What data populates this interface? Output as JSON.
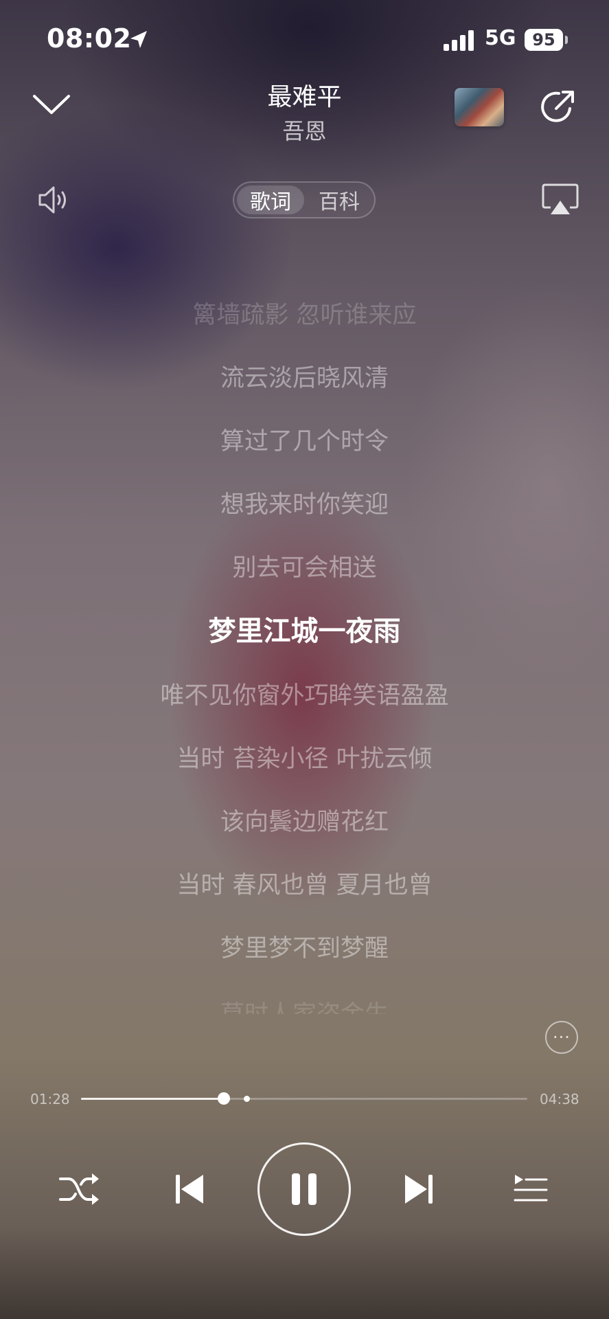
{
  "status_bar": {
    "time": "08:02",
    "network": "5G",
    "battery": "95",
    "icons": [
      "location-arrow-icon",
      "cellular-signal-icon"
    ]
  },
  "header": {
    "title": "最难平",
    "artist": "吾恩",
    "icons": [
      "chevron-down-icon",
      "album-cover-thumbnail",
      "share-icon"
    ]
  },
  "tabs": {
    "lyrics": "歌词",
    "wiki": "百科",
    "selected": "歌词"
  },
  "lyrics": [
    "篱墙疏影 忽听谁来应",
    "流云淡后晓风清",
    "算过了几个时令",
    "想我来时你笑迎",
    "别去可会相送",
    "梦里江城一夜雨",
    "唯不见你窗外巧眸笑语盈盈",
    "当时 苔染小径 叶扰云倾",
    "该向鬓边赠花红",
    "当时 春风也曾 夏月也曾",
    "梦里梦不到梦醒",
    "莫时人家盗金生"
  ],
  "current_lyric_index": 5,
  "more_label": "···",
  "progress": {
    "elapsed": "01:28",
    "total": "04:38",
    "played_fraction": 0.32,
    "buffered_fraction": 0.37
  },
  "controls": {
    "icons": [
      "shuffle-icon",
      "previous-track-icon",
      "pause-icon",
      "next-track-icon",
      "playlist-icon"
    ],
    "playing": true
  },
  "colors": {
    "text_primary": "#ffffff",
    "background_top": "#3d3646",
    "background_mid": "#85787a",
    "background_bottom": "#3f3733",
    "accent_glow": "#782838"
  }
}
